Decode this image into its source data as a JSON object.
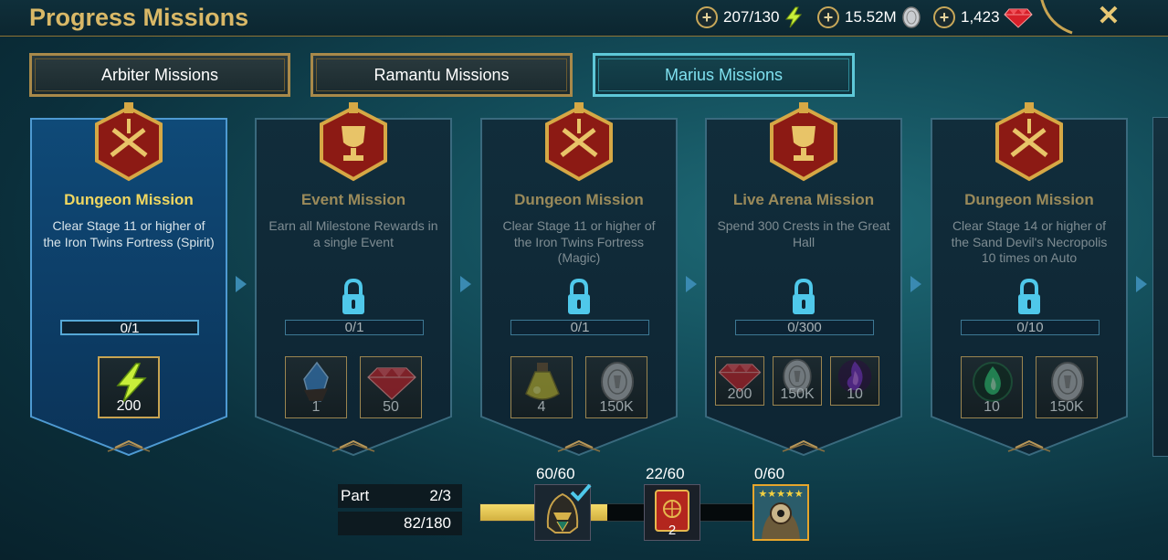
{
  "header": {
    "title": "Progress Missions",
    "energy": "207/130",
    "silver": "15.52M",
    "gems": "1,423",
    "icons": [
      "plus-icon",
      "lightning-icon",
      "silver-coin-icon",
      "gem-icon",
      "close-icon"
    ]
  },
  "tabs": [
    {
      "label": "Arbiter Missions",
      "active": false
    },
    {
      "label": "Ramantu Missions",
      "active": false
    },
    {
      "label": "Marius Missions",
      "active": true
    }
  ],
  "missions": [
    {
      "title": "Dungeon Mission",
      "desc": "Clear Stage 11 or higher of the Iron Twins Fortress (Spirit)",
      "progress": "0/1",
      "locked": false,
      "emblem": "crossed-swords-emblem",
      "rewards": [
        {
          "icon": "lightning-icon",
          "value": "200"
        }
      ]
    },
    {
      "title": "Event Mission",
      "desc": "Earn all Milestone Rewards in a single Event",
      "progress": "0/1",
      "locked": true,
      "emblem": "trophy-emblem",
      "rewards": [
        {
          "icon": "shard-icon",
          "value": "1"
        },
        {
          "icon": "gem-icon",
          "value": "50"
        }
      ]
    },
    {
      "title": "Dungeon Mission",
      "desc": "Clear Stage 11 or higher of the Iron Twins Fortress (Magic)",
      "progress": "0/1",
      "locked": true,
      "emblem": "crossed-swords-emblem",
      "rewards": [
        {
          "icon": "potion-icon",
          "value": "4"
        },
        {
          "icon": "silver-coin-icon",
          "value": "150K"
        }
      ]
    },
    {
      "title": "Live Arena Mission",
      "desc": "Spend 300 Crests in the Great Hall",
      "progress": "0/300",
      "locked": true,
      "emblem": "trophy-emblem",
      "rewards": [
        {
          "icon": "gem-icon",
          "value": "200"
        },
        {
          "icon": "silver-coin-icon",
          "value": "150K"
        },
        {
          "icon": "purple-flame-icon",
          "value": "10"
        }
      ]
    },
    {
      "title": "Dungeon Mission",
      "desc": "Clear Stage 14 or higher of the Sand Devil's Necropolis 10 times on Auto",
      "progress": "0/10",
      "locked": true,
      "emblem": "crossed-swords-emblem",
      "rewards": [
        {
          "icon": "green-flame-icon",
          "value": "10"
        },
        {
          "icon": "silver-coin-icon",
          "value": "150K"
        }
      ]
    }
  ],
  "part": {
    "label": "Part",
    "value": "2/3",
    "points": "82/180",
    "fill_fraction": 0.455
  },
  "milestones": [
    {
      "label": "60/60",
      "icon": "helmet-icon",
      "value": "",
      "done": true
    },
    {
      "label": "22/60",
      "icon": "book-icon",
      "value": "2",
      "done": false
    },
    {
      "label": "0/60",
      "icon": "champion-portrait-icon",
      "value": "",
      "done": false
    }
  ],
  "colors": {
    "gold": "#d9b867",
    "cyan": "#7fe0ef",
    "active_title": "#f0d760",
    "locked_text": "#8a9498"
  }
}
